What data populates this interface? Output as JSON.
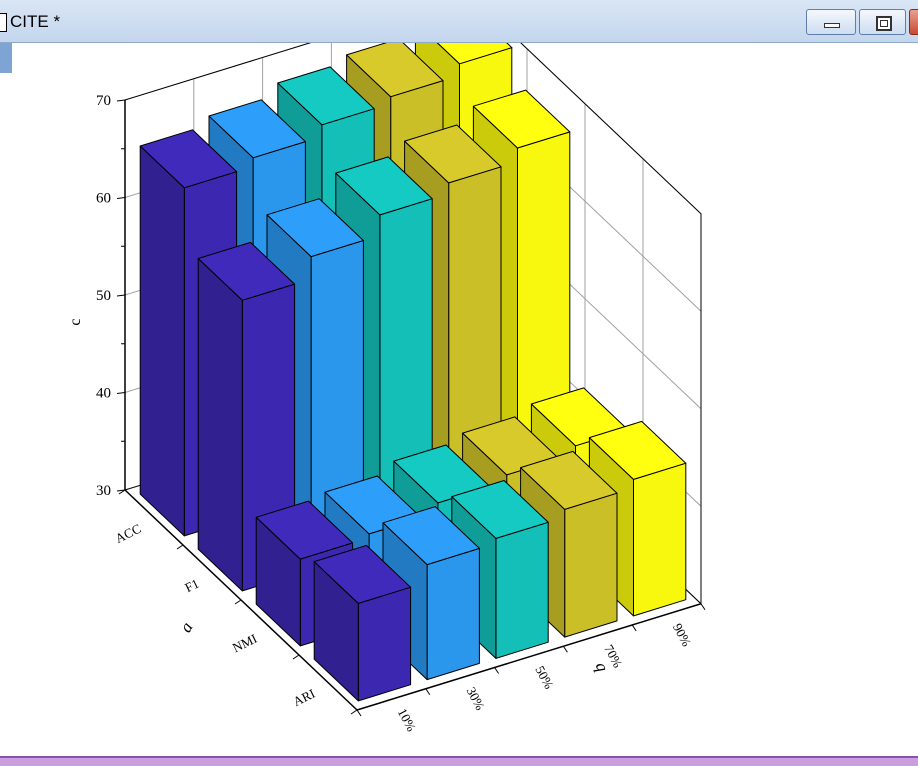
{
  "window": {
    "title": "CITE *"
  },
  "chart_data": {
    "type": "bar",
    "subtype": "3d-bar",
    "z_axis": {
      "label": "c",
      "range": [
        30,
        70
      ],
      "ticks": [
        "30",
        "40",
        "50",
        "60",
        "70"
      ]
    },
    "row_axis": {
      "label": "a",
      "categories": [
        "ACC",
        "F1",
        "NMI",
        "ARI"
      ]
    },
    "col_axis": {
      "label": "b",
      "categories": [
        "10%",
        "30%",
        "50%",
        "70%",
        "90%"
      ]
    },
    "series": [
      {
        "name": "ACC",
        "values": [
          65.7,
          66.6,
          67.8,
          68.5,
          69.7
        ]
      },
      {
        "name": "F1",
        "values": [
          59.8,
          62.1,
          64.2,
          65.3,
          66.7
        ]
      },
      {
        "name": "NMI",
        "values": [
          38.9,
          39.3,
          40.3,
          41.0,
          41.8
        ]
      },
      {
        "name": "ARI",
        "values": [
          40.0,
          41.8,
          42.3,
          43.1,
          44.0
        ]
      }
    ],
    "colors": [
      "#3c28b0",
      "#2a96ec",
      "#14bfb8",
      "#cbbf28",
      "#f8f80e"
    ],
    "grid": true
  }
}
